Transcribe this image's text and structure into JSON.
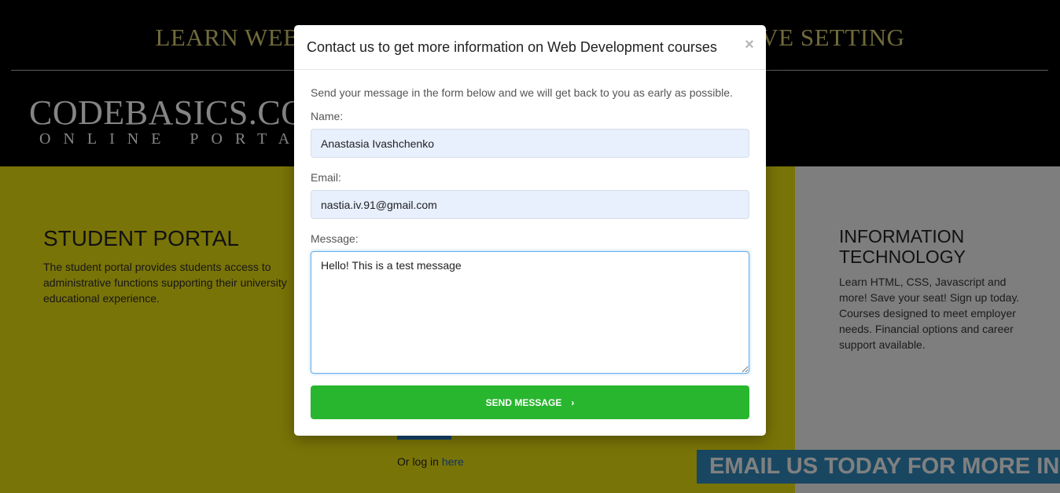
{
  "header": {
    "tagline_left": "LEARN WEB",
    "tagline_right": "VE SETTING",
    "brand": "CODEBASICS.CO",
    "brand_sub": "ONLINE PORTAL"
  },
  "student_portal": {
    "title": "STUDENT PORTAL",
    "description": "The student portal provides students access to administrative functions supporting their university educational experience."
  },
  "login": {
    "prefix": "Or log in",
    "link_label": "here"
  },
  "it_section": {
    "title": "INFORMATION TECHNOLOGY",
    "description": "Learn HTML, CSS, Javascript and more! Save your seat! Sign up today. Courses designed to meet employer needs. Financial options and career support available."
  },
  "banner": {
    "text": "EMAIL US TODAY FOR MORE INFO!"
  },
  "modal": {
    "title": "Contact us to get more information on Web Development courses",
    "close_glyph": "×",
    "intro": "Send your message in the form below and we will get back to you as early as possible.",
    "name_label": "Name:",
    "name_value": "Anastasia Ivashchenko",
    "email_label": "Email:",
    "email_value": "nastia.iv.91@gmail.com",
    "message_label": "Message:",
    "message_value": "Hello! This is a test message",
    "send_label": "SEND MESSAGE",
    "send_chevron": "›"
  },
  "colors": {
    "primary_green": "#29b62f",
    "tagline_gold": "#cdc36c",
    "panel_yellow": "#ddd30e",
    "banner_blue": "#2f82b1"
  }
}
